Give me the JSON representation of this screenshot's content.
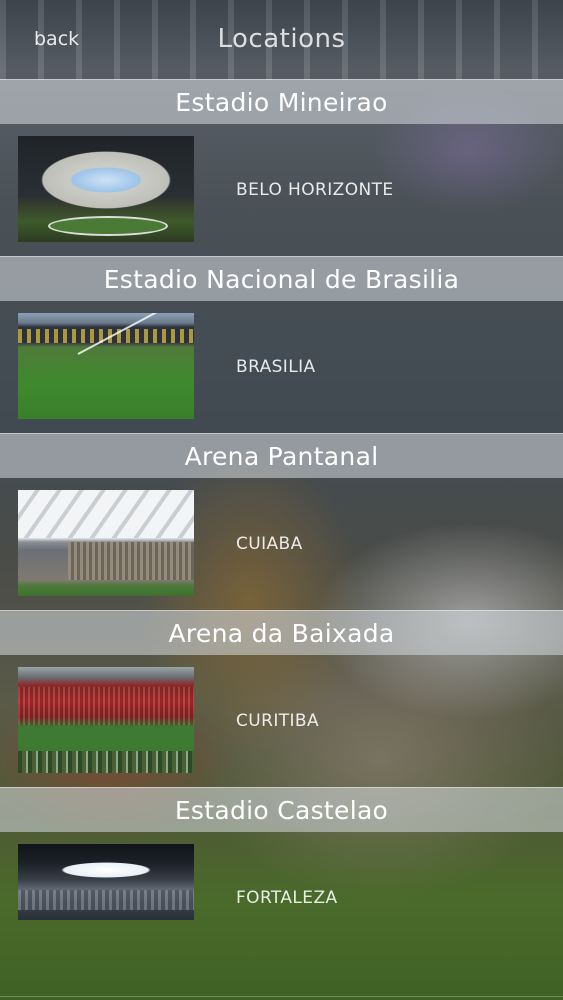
{
  "nav": {
    "back_label": "back",
    "title": "Locations"
  },
  "locations": [
    {
      "stadium": "Estadio Mineirao",
      "city": "BELO HORIZONTE"
    },
    {
      "stadium": "Estadio Nacional de Brasilia",
      "city": "BRASILIA"
    },
    {
      "stadium": "Arena Pantanal",
      "city": "CUIABA"
    },
    {
      "stadium": "Arena da Baixada",
      "city": "CURITIBA"
    },
    {
      "stadium": "Estadio Castelao",
      "city": "FORTALEZA"
    }
  ]
}
